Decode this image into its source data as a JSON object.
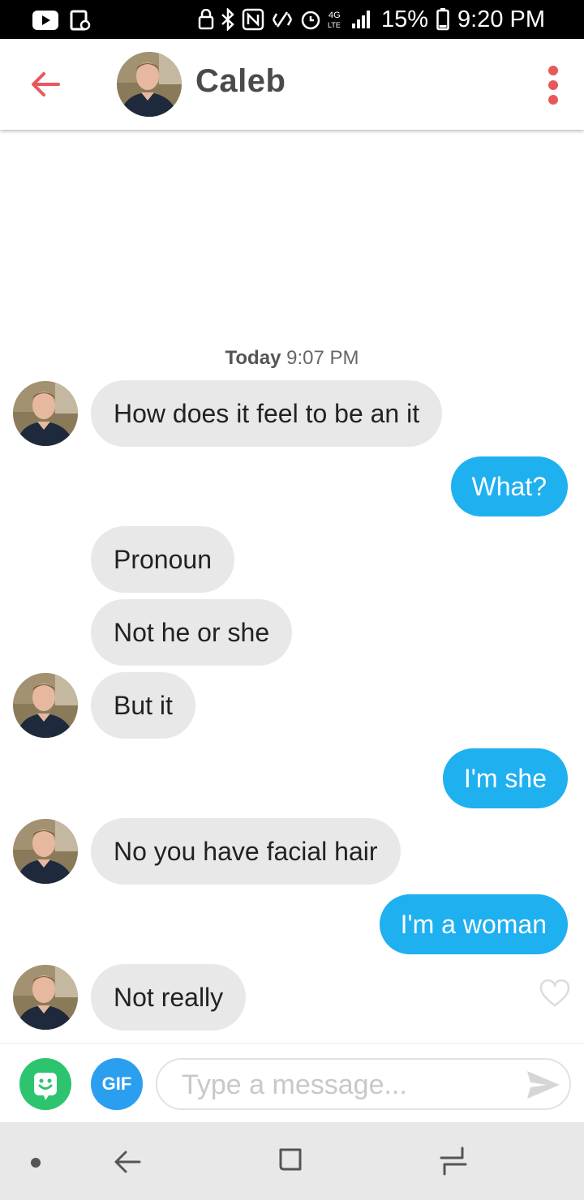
{
  "status_bar": {
    "battery": "15%",
    "time": "9:20 PM",
    "icons": [
      "youtube-icon",
      "screen-record-icon",
      "lock-icon",
      "bluetooth-icon",
      "nfc-icon",
      "vibrate-icon",
      "alarm-icon",
      "lte-icon",
      "signal-icon",
      "battery-icon"
    ]
  },
  "header": {
    "contact_name": "Caleb",
    "back_icon": "back-arrow-icon",
    "menu_icon": "more-vertical-icon"
  },
  "conversation": {
    "timestamp_day": "Today",
    "timestamp_time": "9:07 PM",
    "messages": [
      {
        "side": "in",
        "text": "How does it feel to be an it"
      },
      {
        "side": "out",
        "text": "What?"
      },
      {
        "side": "in",
        "text": "Pronoun"
      },
      {
        "side": "in",
        "text": "Not he or she"
      },
      {
        "side": "in",
        "text": "But it"
      },
      {
        "side": "out",
        "text": "I'm she"
      },
      {
        "side": "in",
        "text": "No you have facial hair"
      },
      {
        "side": "out",
        "text": "I'm a woman"
      },
      {
        "side": "in",
        "text": "Not really"
      }
    ]
  },
  "composer": {
    "gif_label": "GIF",
    "placeholder": "Type a message...",
    "sticker_icon": "sticker-icon",
    "send_icon": "send-icon"
  },
  "nav_bar": {
    "icons": [
      "nav-dot-icon",
      "nav-back-icon",
      "nav-home-icon",
      "nav-recent-icon"
    ]
  },
  "colors": {
    "accent": "#e8585a",
    "outgoing_bubble": "#1fb0f0",
    "incoming_bubble": "#e8e8e8",
    "sticker_button": "#2cc46e",
    "gif_button": "#2a9ff0"
  }
}
